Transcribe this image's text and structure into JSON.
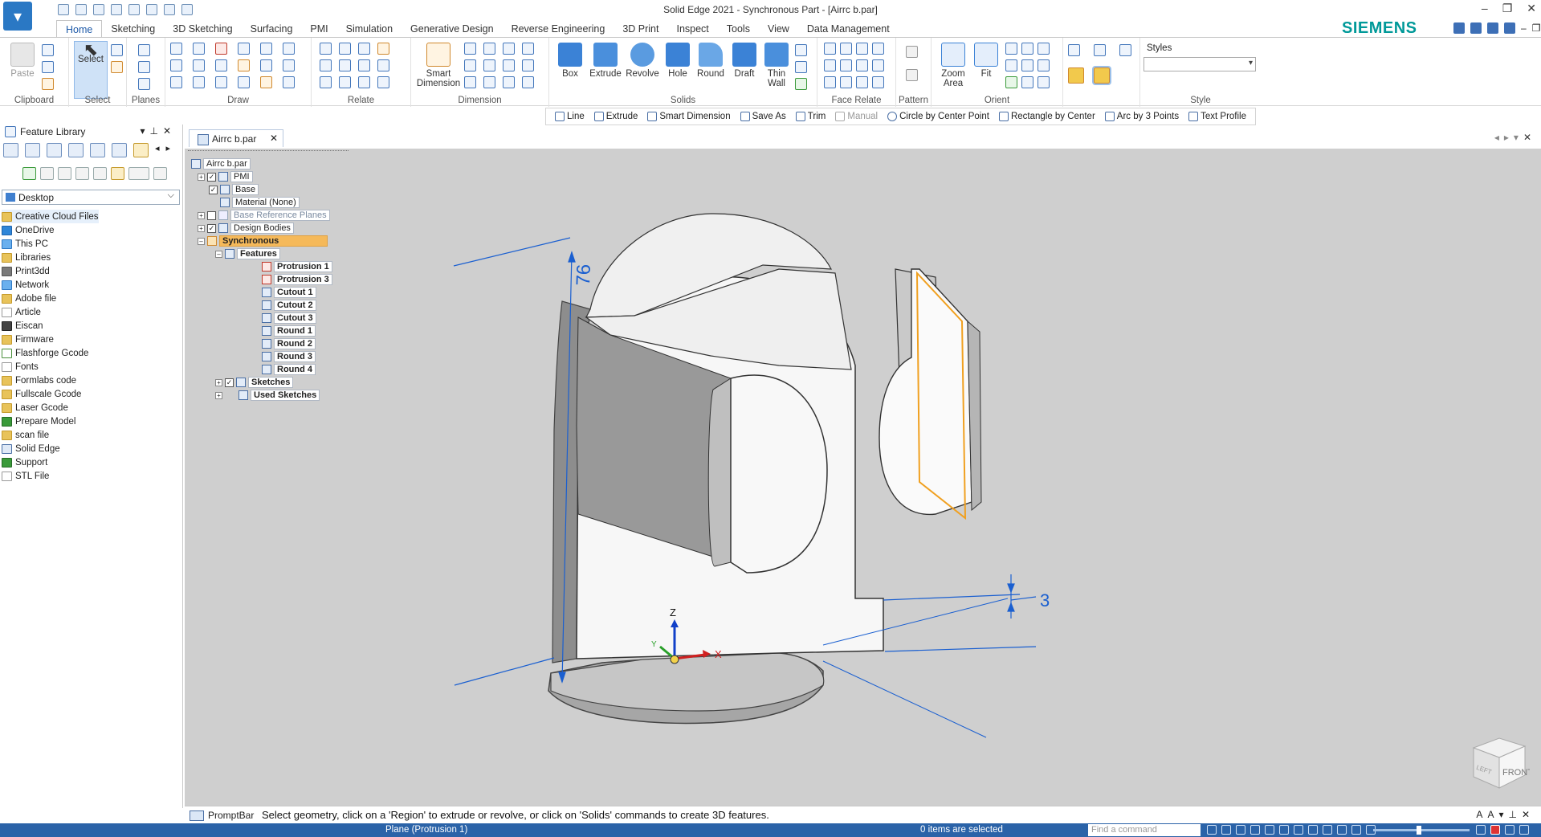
{
  "window": {
    "title": "Solid Edge 2021 - Synchronous Part - [Airrc b.par]",
    "brand": "SIEMENS"
  },
  "tabs": [
    "Home",
    "Sketching",
    "3D Sketching",
    "Surfacing",
    "PMI",
    "Simulation",
    "Generative Design",
    "Reverse Engineering",
    "3D Print",
    "Inspect",
    "Tools",
    "View",
    "Data Management"
  ],
  "ribbon": {
    "groups": {
      "clipboard": "Clipboard",
      "select": "Select",
      "planes": "Planes",
      "draw": "Draw",
      "relate": "Relate",
      "dimension": "Dimension",
      "solids": "Solids",
      "face_relate": "Face Relate",
      "pattern": "Pattern",
      "orient": "Orient",
      "style": "Style"
    },
    "buttons": {
      "paste": "Paste",
      "select": "Select",
      "smart_dimension_1": "Smart",
      "smart_dimension_2": "Dimension",
      "box": "Box",
      "extrude": "Extrude",
      "revolve": "Revolve",
      "hole": "Hole",
      "round": "Round",
      "draft": "Draft",
      "thin_wall_1": "Thin",
      "thin_wall_2": "Wall",
      "zoom_area_1": "Zoom",
      "zoom_area_2": "Area",
      "fit": "Fit"
    },
    "styles_label": "Styles"
  },
  "command_bar": [
    "Line",
    "Extrude",
    "Smart Dimension",
    "Save As",
    "Trim",
    "Manual",
    "Circle by Center Point",
    "Rectangle by Center",
    "Arc by 3 Points",
    "Text Profile"
  ],
  "feature_library": {
    "title": "Feature Library",
    "location": "Desktop",
    "items": [
      "Creative Cloud Files",
      "OneDrive",
      "This PC",
      "Libraries",
      "Print3dd",
      "Network",
      "Adobe file",
      "Article",
      "Eiscan",
      "Firmware",
      "Flashforge Gcode",
      "Fonts",
      "Formlabs code",
      "Fullscale Gcode",
      "Laser Gcode",
      "Prepare Model",
      "scan file",
      "Solid Edge",
      "Support",
      "STL File"
    ]
  },
  "document_tab": "Airrc b.par",
  "pathfinder": {
    "root": "Airrc b.par",
    "pmi": "PMI",
    "base": "Base",
    "material": "Material (None)",
    "base_reference_planes": "Base Reference Planes",
    "design_bodies": "Design Bodies",
    "synchronous": "Synchronous",
    "features": "Features",
    "feature_items": [
      "Protrusion 1",
      "Protrusion 3",
      "Cutout 1",
      "Cutout 2",
      "Cutout 3",
      "Round 1",
      "Round 2",
      "Round 3",
      "Round 4"
    ],
    "sketches": "Sketches",
    "used_sketches": "Used Sketches"
  },
  "model": {
    "dimension_height": "76",
    "dimension_thickness": "3",
    "axis_z": "Z",
    "axis_x": "X",
    "axis_y": "Y",
    "view_cube_front": "FRONT",
    "view_cube_left": "LEFT",
    "colors": {
      "background": "#cfcfcf",
      "dimension": "#1a5fd0",
      "highlight": "#f0a020"
    }
  },
  "prompt_bar": {
    "label": "PromptBar",
    "text": "Select geometry, click on a 'Region' to extrude or revolve, or click on 'Solids' commands to create 3D features."
  },
  "status_bar": {
    "left": "Plane (Protrusion 1)",
    "middle": "0 items are selected",
    "find_placeholder": "Find a command"
  }
}
